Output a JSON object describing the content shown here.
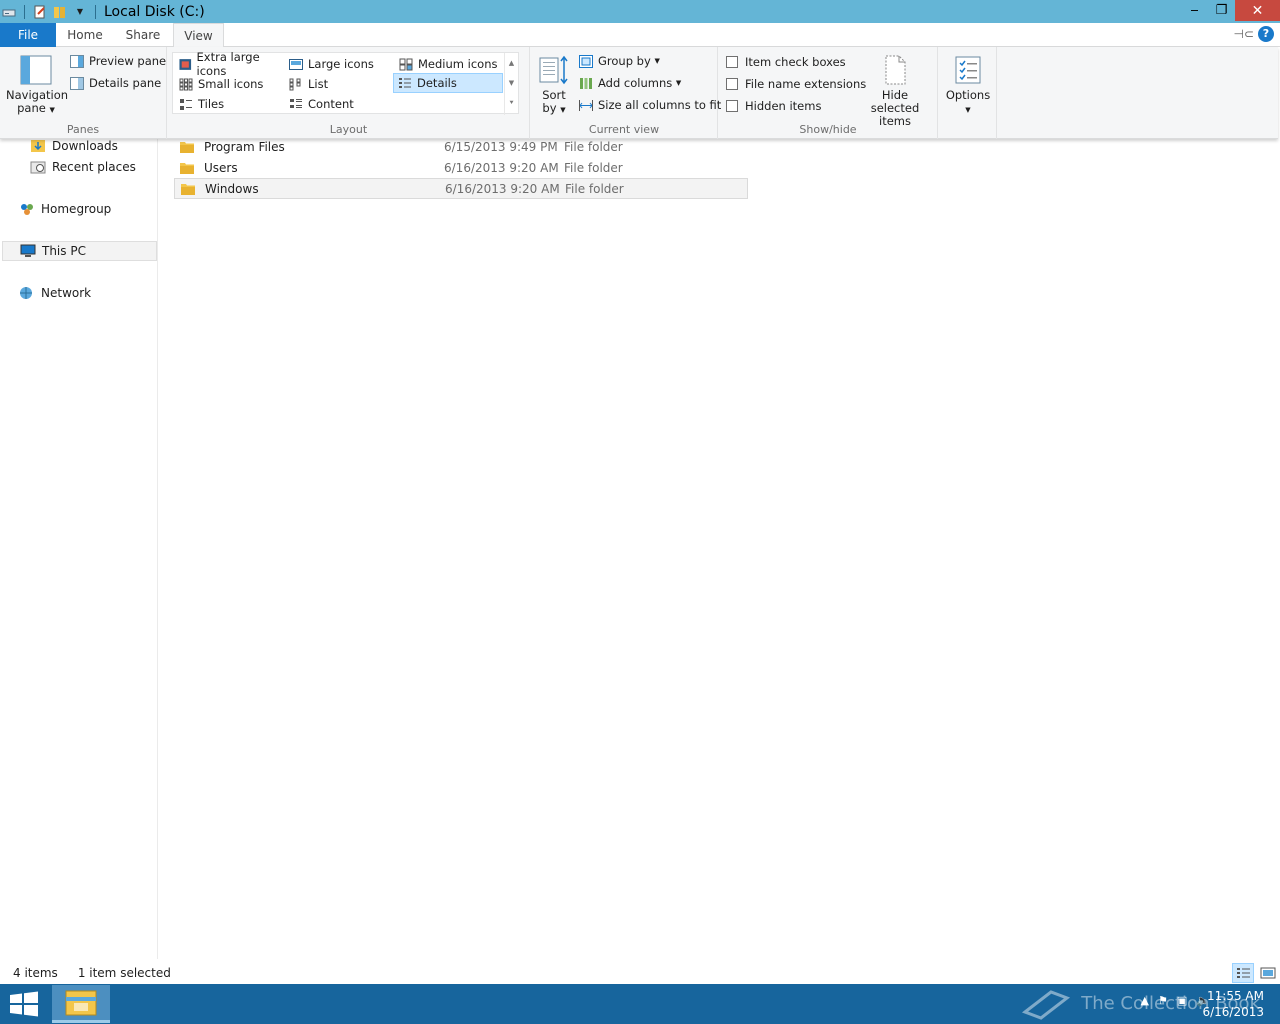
{
  "window": {
    "title": "Local Disk (C:)",
    "minimize": "‒",
    "maximize": "❐",
    "close": "✕"
  },
  "tabs": {
    "file": "File",
    "home": "Home",
    "share": "Share",
    "view": "View"
  },
  "ribbon": {
    "panes": {
      "label": "Panes",
      "navigation_pane": "Navigation",
      "navigation_pane_2": "pane",
      "preview_pane": "Preview pane",
      "details_pane": "Details pane"
    },
    "layout": {
      "label": "Layout",
      "extra_large_icons": "Extra large icons",
      "large_icons": "Large icons",
      "medium_icons": "Medium icons",
      "small_icons": "Small icons",
      "list": "List",
      "details": "Details",
      "tiles": "Tiles",
      "content": "Content"
    },
    "current_view": {
      "label": "Current view",
      "sort_by": "Sort",
      "sort_by_2": "by",
      "group_by": "Group by",
      "add_columns": "Add columns",
      "size_all_columns": "Size all columns to fit"
    },
    "show_hide": {
      "label": "Show/hide",
      "item_check_boxes": "Item check boxes",
      "file_name_extensions": "File name extensions",
      "hidden_items": "Hidden items",
      "hide_selected": "Hide selected",
      "hide_selected_2": "items"
    },
    "options": {
      "label": "Options"
    }
  },
  "nav": {
    "downloads": "Downloads",
    "recent_places": "Recent places",
    "homegroup": "Homegroup",
    "this_pc": "This PC",
    "network": "Network"
  },
  "files": [
    {
      "name": "Program Files",
      "date": "6/15/2013 9:49 PM",
      "type": "File folder"
    },
    {
      "name": "Users",
      "date": "6/16/2013 9:20 AM",
      "type": "File folder"
    },
    {
      "name": "Windows",
      "date": "6/16/2013 9:20 AM",
      "type": "File folder"
    }
  ],
  "status": {
    "count": "4 items",
    "selected": "1 item selected"
  },
  "taskbar": {
    "time": "11:55 AM",
    "date": "6/16/2013",
    "watermark": "The Collection Book"
  },
  "colors": {
    "titlebar": "#64b5d6",
    "file_tab": "#1979ca",
    "taskbar": "#17659d",
    "close": "#c7493f"
  }
}
